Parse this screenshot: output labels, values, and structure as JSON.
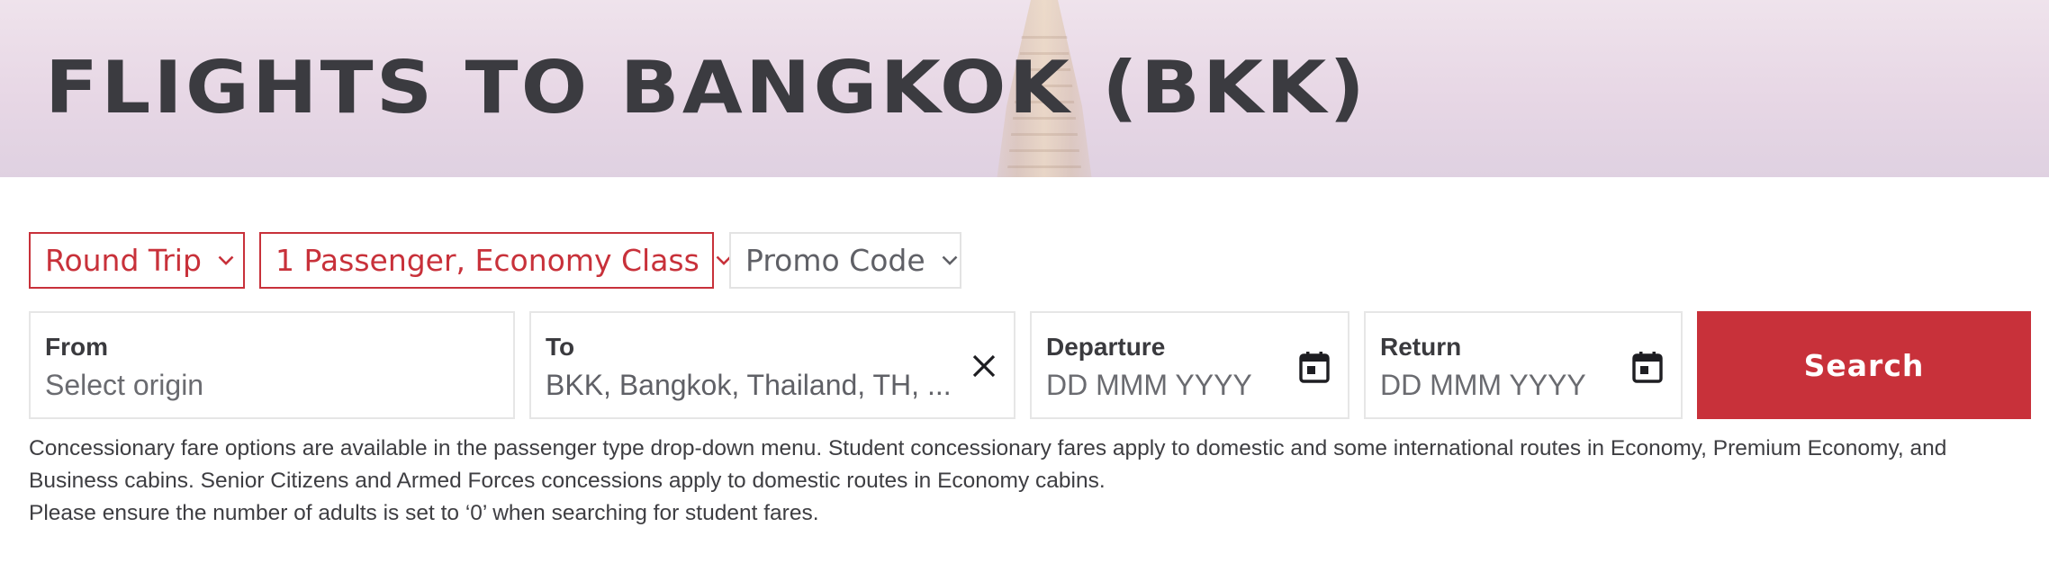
{
  "hero": {
    "title": "FLIGHTS TO BANGKOK (BKK)"
  },
  "controls": {
    "trip_type": "Round Trip",
    "passengers": "1 Passenger, Economy Class",
    "promo": "Promo Code"
  },
  "fields": {
    "from": {
      "label": "From",
      "placeholder": "Select origin"
    },
    "to": {
      "label": "To",
      "value": "BKK, Bangkok, Thailand, TH, ..."
    },
    "departure": {
      "label": "Departure",
      "placeholder": "DD MMM YYYY"
    },
    "return": {
      "label": "Return",
      "placeholder": "DD MMM YYYY"
    }
  },
  "search_label": "Search",
  "notes": {
    "line1": "Concessionary fare options are available in the passenger type drop-down menu. Student concessionary fares apply to domestic and some international routes in Economy, Premium Economy, and",
    "line2": "Business cabins. Senior Citizens and Armed Forces concessions apply to domestic routes in Economy cabins.",
    "line3": "Please ensure the number of adults is set to ‘0’ when searching for student fares."
  },
  "colors": {
    "accent": "#c8313a",
    "text": "#3a3a3e",
    "border": "#e6e6e6"
  },
  "icons": [
    "chevron-down-icon",
    "close-icon",
    "calendar-icon"
  ]
}
